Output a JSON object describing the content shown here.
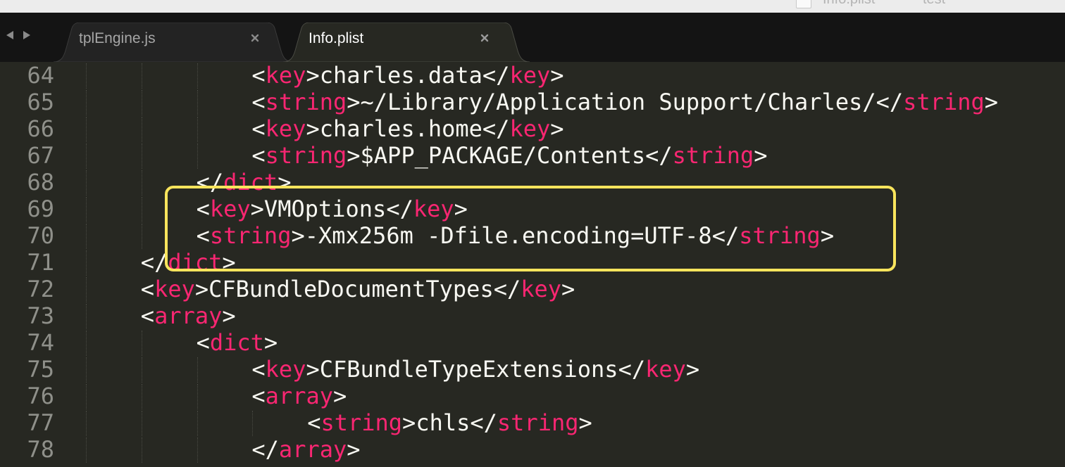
{
  "top_strip": {
    "peek_items": [
      "Info.plist",
      "test"
    ]
  },
  "tabs": [
    {
      "label": "tplEngine.js",
      "active": false
    },
    {
      "label": "Info.plist",
      "active": true
    }
  ],
  "icons": {
    "back": "chevron-left-icon",
    "forward": "chevron-right-icon",
    "close": "close-icon"
  },
  "colors": {
    "background": "#272822",
    "tag": "#f92672",
    "text": "#f8f8f2",
    "line_number": "#8f908a",
    "highlight_border": "#f8e45c"
  },
  "editor": {
    "lines": [
      {
        "num": "64",
        "indent": 3,
        "tokens": [
          [
            "p",
            "<"
          ],
          [
            "t",
            "key"
          ],
          [
            "p",
            ">"
          ],
          [
            "x",
            "charles.data"
          ],
          [
            "p",
            "</"
          ],
          [
            "t",
            "key"
          ],
          [
            "p",
            ">"
          ]
        ]
      },
      {
        "num": "65",
        "indent": 3,
        "tokens": [
          [
            "p",
            "<"
          ],
          [
            "t",
            "string"
          ],
          [
            "p",
            ">"
          ],
          [
            "x",
            "~/Library/Application Support/Charles/"
          ],
          [
            "p",
            "</"
          ],
          [
            "t",
            "string"
          ],
          [
            "p",
            ">"
          ]
        ]
      },
      {
        "num": "66",
        "indent": 3,
        "tokens": [
          [
            "p",
            "<"
          ],
          [
            "t",
            "key"
          ],
          [
            "p",
            ">"
          ],
          [
            "x",
            "charles.home"
          ],
          [
            "p",
            "</"
          ],
          [
            "t",
            "key"
          ],
          [
            "p",
            ">"
          ]
        ]
      },
      {
        "num": "67",
        "indent": 3,
        "tokens": [
          [
            "p",
            "<"
          ],
          [
            "t",
            "string"
          ],
          [
            "p",
            ">"
          ],
          [
            "x",
            "$APP_PACKAGE/Contents"
          ],
          [
            "p",
            "</"
          ],
          [
            "t",
            "string"
          ],
          [
            "p",
            ">"
          ]
        ]
      },
      {
        "num": "68",
        "indent": 2,
        "tokens": [
          [
            "p",
            "</"
          ],
          [
            "t",
            "dict"
          ],
          [
            "p",
            ">"
          ]
        ]
      },
      {
        "num": "69",
        "indent": 2,
        "tokens": [
          [
            "p",
            "<"
          ],
          [
            "t",
            "key"
          ],
          [
            "p",
            ">"
          ],
          [
            "x",
            "VMOptions"
          ],
          [
            "p",
            "</"
          ],
          [
            "t",
            "key"
          ],
          [
            "p",
            ">"
          ]
        ]
      },
      {
        "num": "70",
        "indent": 2,
        "tokens": [
          [
            "p",
            "<"
          ],
          [
            "t",
            "string"
          ],
          [
            "p",
            ">"
          ],
          [
            "x",
            "-Xmx256m -Dfile.encoding=UTF-8"
          ],
          [
            "p",
            "</"
          ],
          [
            "t",
            "string"
          ],
          [
            "p",
            ">"
          ]
        ]
      },
      {
        "num": "71",
        "indent": 1,
        "tokens": [
          [
            "p",
            "</"
          ],
          [
            "t",
            "dict"
          ],
          [
            "p",
            ">"
          ]
        ]
      },
      {
        "num": "72",
        "indent": 1,
        "tokens": [
          [
            "p",
            "<"
          ],
          [
            "t",
            "key"
          ],
          [
            "p",
            ">"
          ],
          [
            "x",
            "CFBundleDocumentTypes"
          ],
          [
            "p",
            "</"
          ],
          [
            "t",
            "key"
          ],
          [
            "p",
            ">"
          ]
        ]
      },
      {
        "num": "73",
        "indent": 1,
        "tokens": [
          [
            "p",
            "<"
          ],
          [
            "t",
            "array"
          ],
          [
            "p",
            ">"
          ]
        ]
      },
      {
        "num": "74",
        "indent": 2,
        "tokens": [
          [
            "p",
            "<"
          ],
          [
            "t",
            "dict"
          ],
          [
            "p",
            ">"
          ]
        ]
      },
      {
        "num": "75",
        "indent": 3,
        "tokens": [
          [
            "p",
            "<"
          ],
          [
            "t",
            "key"
          ],
          [
            "p",
            ">"
          ],
          [
            "x",
            "CFBundleTypeExtensions"
          ],
          [
            "p",
            "</"
          ],
          [
            "t",
            "key"
          ],
          [
            "p",
            ">"
          ]
        ]
      },
      {
        "num": "76",
        "indent": 3,
        "tokens": [
          [
            "p",
            "<"
          ],
          [
            "t",
            "array"
          ],
          [
            "p",
            ">"
          ]
        ]
      },
      {
        "num": "77",
        "indent": 4,
        "tokens": [
          [
            "p",
            "<"
          ],
          [
            "t",
            "string"
          ],
          [
            "p",
            ">"
          ],
          [
            "x",
            "chls"
          ],
          [
            "p",
            "</"
          ],
          [
            "t",
            "string"
          ],
          [
            "p",
            ">"
          ]
        ]
      },
      {
        "num": "78",
        "indent": 3,
        "tokens": [
          [
            "p",
            "</"
          ],
          [
            "t",
            "array"
          ],
          [
            "p",
            ">"
          ]
        ]
      }
    ]
  }
}
